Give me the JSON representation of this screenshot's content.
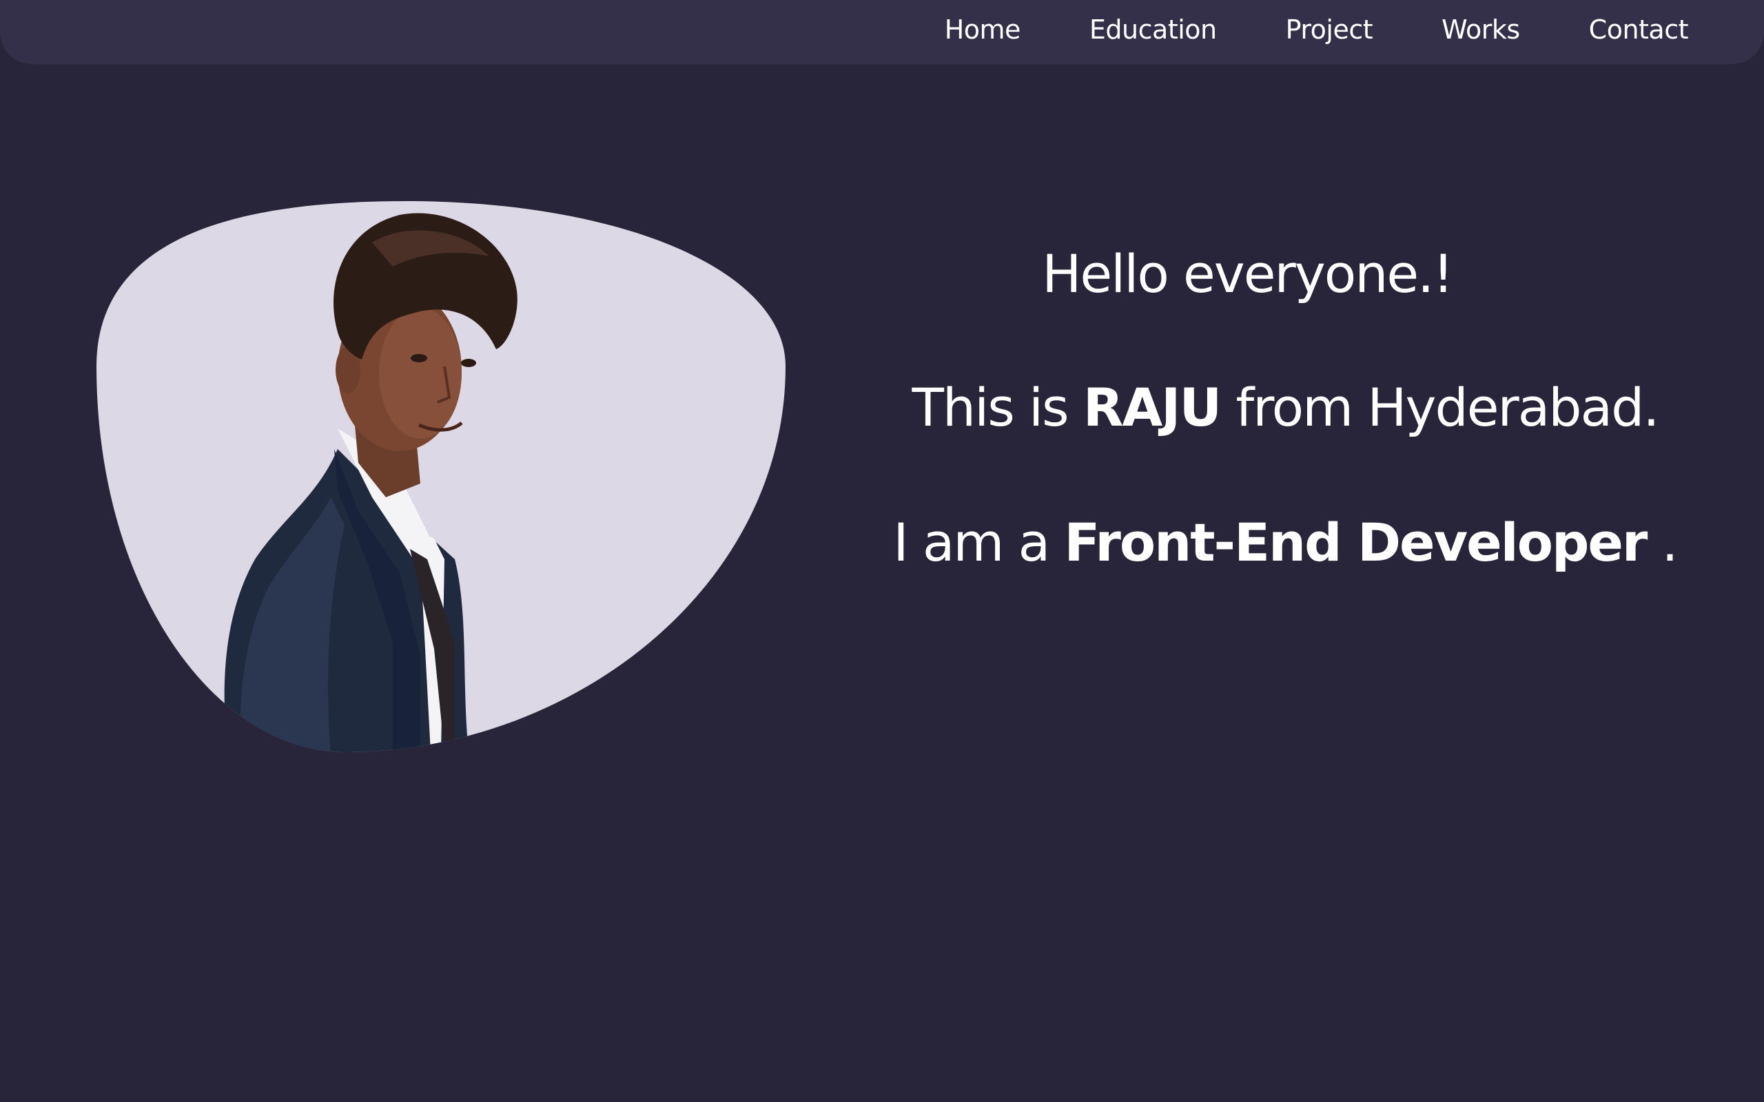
{
  "nav": {
    "items": [
      {
        "label": "Home"
      },
      {
        "label": "Education"
      },
      {
        "label": "Project"
      },
      {
        "label": "Works"
      },
      {
        "label": "Contact"
      }
    ]
  },
  "hero": {
    "greeting": "Hello everyone.!",
    "intro_prefix": "This is ",
    "name": "RAJU",
    "intro_suffix": " from Hyderabad.",
    "role_prefix": "I am a ",
    "role": "Front-End Developer",
    "role_suffix": " ."
  },
  "colors": {
    "background": "#28243a",
    "navbar": "#343049",
    "blob": "#dcd8e5",
    "text": "#ffffff"
  },
  "icons": {
    "profile_photo": "person-portrait"
  }
}
